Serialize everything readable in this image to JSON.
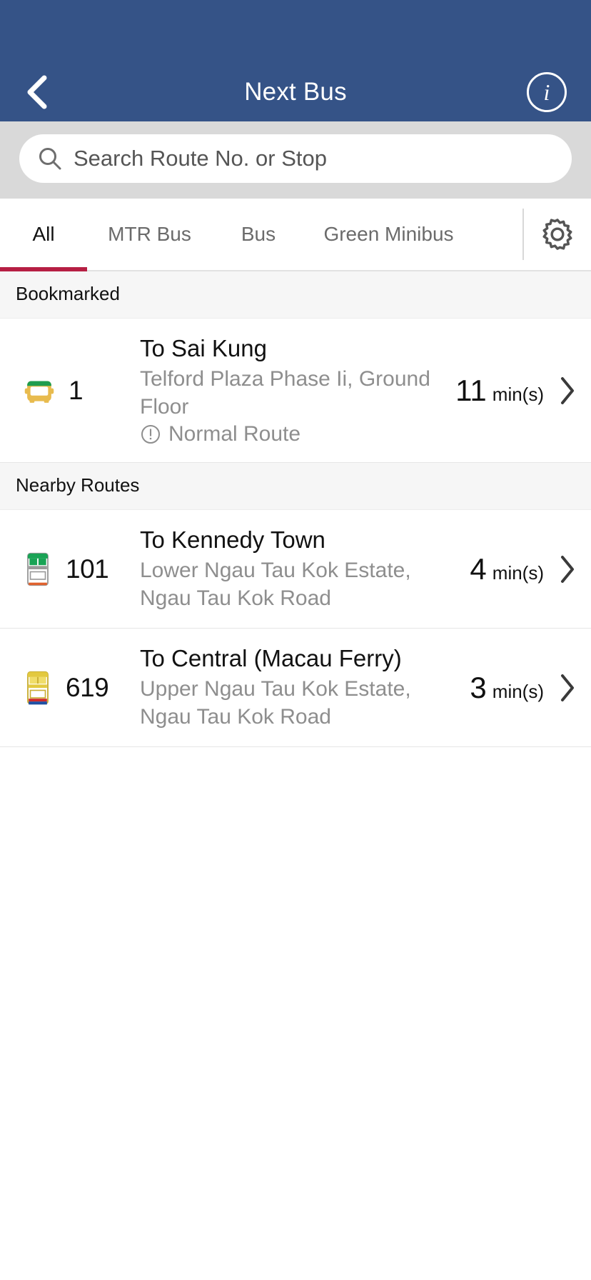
{
  "header": {
    "title": "Next Bus",
    "back_icon": "chevron-left-icon",
    "info_icon": "info-circle-icon",
    "info_glyph": "i",
    "bg_color": "#355387"
  },
  "search": {
    "placeholder": "Search Route No. or Stop",
    "value": "",
    "icon": "search-icon"
  },
  "tabs": {
    "items": [
      {
        "label": "All",
        "active": true
      },
      {
        "label": "MTR Bus",
        "active": false
      },
      {
        "label": "Bus",
        "active": false
      },
      {
        "label": "Green Minibus",
        "active": false
      }
    ],
    "active_indicator_color": "#b61f43",
    "settings_icon": "gear-icon"
  },
  "sections": [
    {
      "title": "Bookmarked",
      "rows": [
        {
          "route_no": "1",
          "vehicle_icon": "green-minibus-icon",
          "destination": "To Sai Kung",
          "stop": "Telford Plaza Phase Ii, Ground Floor",
          "notice": "Normal Route",
          "notice_icon": "exclamation-circle-icon",
          "eta_value": "11",
          "eta_unit": "min(s)",
          "chevron_icon": "chevron-right-icon"
        }
      ]
    },
    {
      "title": "Nearby Routes",
      "rows": [
        {
          "route_no": "101",
          "vehicle_icon": "green-double-decker-bus-icon",
          "destination": "To Kennedy Town",
          "stop": "Lower Ngau Tau Kok Estate, Ngau Tau Kok Road",
          "notice": "",
          "notice_icon": "",
          "eta_value": "4",
          "eta_unit": "min(s)",
          "chevron_icon": "chevron-right-icon"
        },
        {
          "route_no": "619",
          "vehicle_icon": "yellow-double-decker-bus-icon",
          "destination": "To Central (Macau Ferry)",
          "stop": "Upper Ngau Tau Kok Estate, Ngau Tau Kok Road",
          "notice": "",
          "notice_icon": "",
          "eta_value": "3",
          "eta_unit": "min(s)",
          "chevron_icon": "chevron-right-icon"
        }
      ]
    }
  ]
}
